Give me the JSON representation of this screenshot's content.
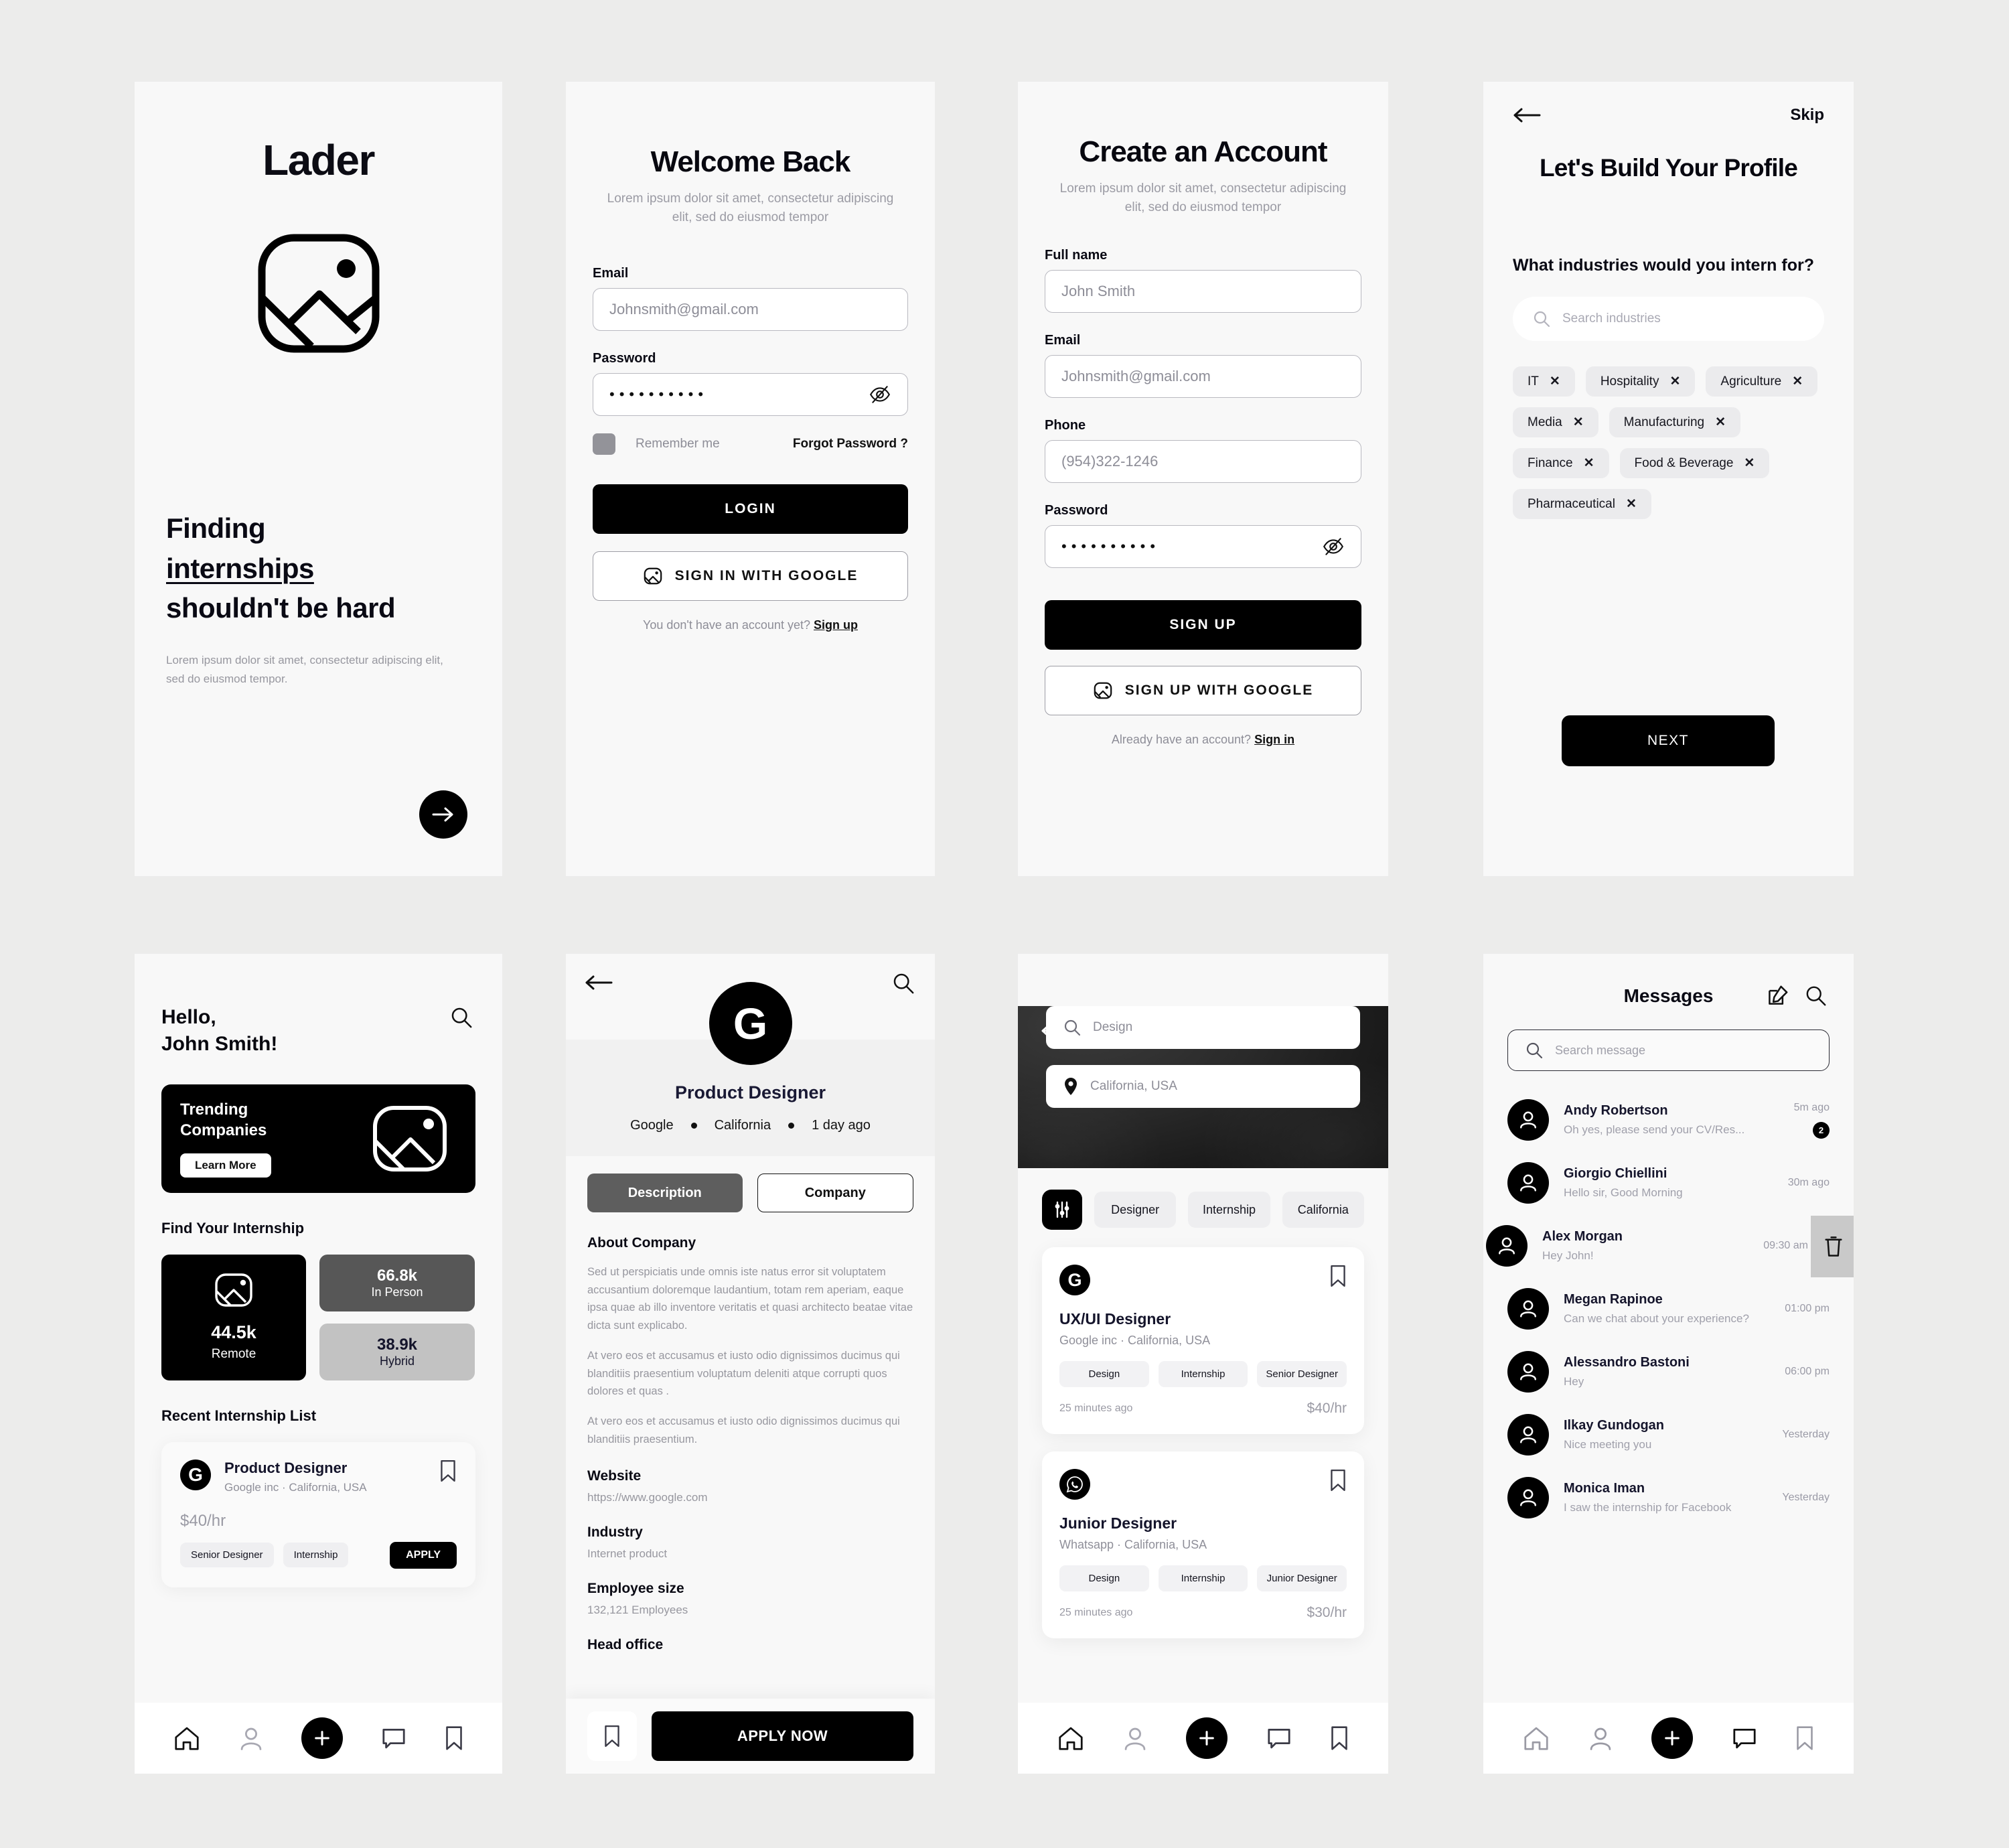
{
  "app": {
    "name": "Lader"
  },
  "screen_welcome": {
    "brand": "Lader",
    "headline_line1": "Finding",
    "headline_line2": "internships",
    "headline_line3": "shouldn't be hard",
    "subtext": "Lorem ipsum dolor sit amet, consectetur adipiscing elit, sed do eiusmod tempor.",
    "next_icon": "arrow-right-icon"
  },
  "screen_login": {
    "title": "Welcome Back",
    "subtitle": "Lorem ipsum dolor sit amet, consectetur adipiscing elit, sed do eiusmod tempor",
    "email_label": "Email",
    "email_value": "Johnsmith@gmail.com",
    "password_label": "Password",
    "password_value": "••••••••••",
    "remember_label": "Remember me",
    "forgot_label": "Forgot Password ?",
    "login_button": "LOGIN",
    "google_button": "SIGN IN WITH GOOGLE",
    "footer_text": "You don't have an account yet?",
    "footer_link": "Sign up"
  },
  "screen_signup": {
    "title": "Create an Account",
    "subtitle": "Lorem ipsum dolor sit amet, consectetur adipiscing elit, sed do eiusmod tempor",
    "fullname_label": "Full name",
    "fullname_value": "John Smith",
    "email_label": "Email",
    "email_value": "Johnsmith@gmail.com",
    "phone_label": "Phone",
    "phone_value": "(954)322-1246",
    "password_label": "Password",
    "password_value": "••••••••••",
    "signup_button": "SIGN UP",
    "google_button": "SIGN UP WITH GOOGLE",
    "footer_text": "Already have an account?",
    "footer_link": "Sign in"
  },
  "screen_profile": {
    "back_icon": "arrow-left-icon",
    "skip_label": "Skip",
    "title": "Let's Build Your Profile",
    "question": "What industries would you intern for?",
    "search_placeholder": "Search industries",
    "industries": [
      "IT",
      "Hospitality",
      "Agriculture",
      "Media",
      "Manufacturing",
      "Finance",
      "Food & Beverage",
      "Pharmaceutical"
    ],
    "next_button": "NEXT"
  },
  "screen_home": {
    "greeting_line1": "Hello,",
    "greeting_line2": "John Smith!",
    "search_icon": "search-icon",
    "banner_title_line1": "Trending",
    "banner_title_line2": "Companies",
    "banner_cta": "Learn More",
    "section_find": "Find Your Internship",
    "tiles": [
      {
        "value": "44.5k",
        "label": "Remote"
      },
      {
        "value": "66.8k",
        "label": "In Person"
      },
      {
        "value": "38.9k",
        "label": "Hybrid"
      }
    ],
    "section_recent": "Recent Internship List",
    "recent_job": {
      "logo_letter": "G",
      "title": "Product Designer",
      "meta": "Google inc · California, USA",
      "pay_amount": "$40",
      "pay_unit": "/hr",
      "tags": [
        "Senior Designer",
        "Internship"
      ],
      "apply_label": "APPLY"
    },
    "tabbar": [
      "home-icon",
      "profile-icon",
      "add-icon",
      "chat-icon",
      "bookmark-icon"
    ]
  },
  "screen_job": {
    "back_icon": "arrow-left-icon",
    "search_icon": "search-icon",
    "logo_letter": "G",
    "role": "Product Designer",
    "company": "Google",
    "location": "California",
    "posted": "1 day ago",
    "tab_description": "Description",
    "tab_company": "Company",
    "about_heading": "About Company",
    "about_p1": "Sed ut perspiciatis unde omnis iste natus error sit voluptatem accusantium doloremque laudantium, totam rem aperiam, eaque ipsa quae ab illo inventore veritatis et quasi architecto beatae vitae dicta sunt explicabo.",
    "about_p2": "At vero eos et accusamus et iusto odio dignissimos ducimus qui blanditiis praesentium voluptatum deleniti atque corrupti quos dolores et quas .",
    "about_p3": "At vero eos et accusamus et iusto odio dignissimos ducimus qui blanditiis praesentium.",
    "website_label": "Website",
    "website_value": "https://www.google.com",
    "industry_label": "Industry",
    "industry_value": "Internet product",
    "employee_label": "Employee size",
    "employee_value": "132,121 Employees",
    "headoffice_label": "Head office",
    "bookmark_icon": "bookmark-icon",
    "apply_button": "APPLY NOW"
  },
  "screen_search": {
    "back_icon": "arrow-left-icon",
    "query_value": "Design",
    "location_value": "California, USA",
    "filter_icon": "filter-icon",
    "filters": [
      "Designer",
      "Internship",
      "California"
    ],
    "results": [
      {
        "logo_letter": "G",
        "logo_icon": "google-icon",
        "title": "UX/UI Designer",
        "meta": "Google inc · California, USA",
        "tags": [
          "Design",
          "Internship",
          "Senior Designer"
        ],
        "ago": "25 minutes ago",
        "pay_amount": "$40",
        "pay_unit": "/hr"
      },
      {
        "logo_letter": "",
        "logo_icon": "whatsapp-icon",
        "title": "Junior Designer",
        "meta": "Whatsapp · California, USA",
        "tags": [
          "Design",
          "Internship",
          "Junior Designer"
        ],
        "ago": "25 minutes ago",
        "pay_amount": "$30",
        "pay_unit": "/hr"
      }
    ]
  },
  "screen_messages": {
    "title": "Messages",
    "compose_icon": "compose-icon",
    "search_icon": "search-icon",
    "search_placeholder": "Search message",
    "delete_icon": "trash-icon",
    "threads": [
      {
        "name": "Andy Robertson",
        "preview": "Oh yes, please send your CV/Res...",
        "time": "5m ago",
        "badge": "2"
      },
      {
        "name": "Giorgio Chiellini",
        "preview": "Hello sir, Good Morning",
        "time": "30m ago",
        "badge": ""
      },
      {
        "name": "Alex Morgan",
        "preview": "Hey John!",
        "time": "09:30 am",
        "badge": ""
      },
      {
        "name": "Megan Rapinoe",
        "preview": "Can we chat about your experience?",
        "time": "01:00 pm",
        "badge": ""
      },
      {
        "name": "Alessandro Bastoni",
        "preview": "Hey",
        "time": "06:00 pm",
        "badge": ""
      },
      {
        "name": "Ilkay Gundogan",
        "preview": "Nice meeting you",
        "time": "Yesterday",
        "badge": ""
      },
      {
        "name": "Monica Iman",
        "preview": "I saw the internship for Facebook",
        "time": "Yesterday",
        "badge": ""
      }
    ]
  },
  "colors": {
    "black": "#000000",
    "page_bg": "#ececeb",
    "screen_bg": "#f8f8f8",
    "muted": "#9a9aa4"
  }
}
